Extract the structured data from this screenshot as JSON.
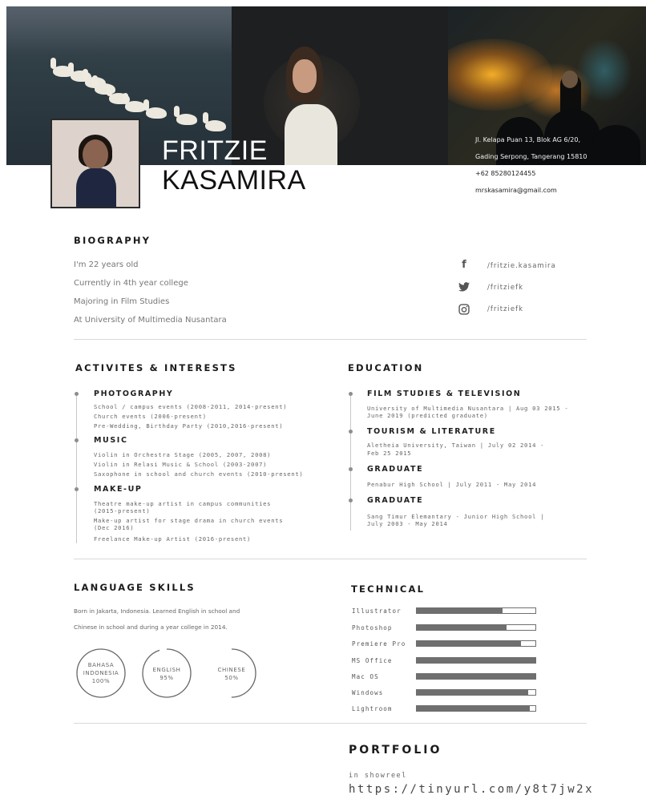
{
  "header": {
    "first_name": "FRITZIE",
    "last_name": "KASAMIRA",
    "address_line1": "Jl. Kelapa Puan 13, Blok AG 6/20,",
    "address_line2": "Gading Serpong, Tangerang 15810",
    "phone": "+62 85280124455",
    "email": "mrskasamira@gmail.com"
  },
  "biography": {
    "heading": "BIOGRAPHY",
    "lines": [
      "I'm 22 years old",
      "Currently in 4th year college",
      "Majoring in Film Studies",
      "At University of Multimedia Nusantara"
    ],
    "social": [
      {
        "icon": "facebook-icon",
        "handle": "/fritzie.kasamira"
      },
      {
        "icon": "twitter-icon",
        "handle": "/fritziefk"
      },
      {
        "icon": "instagram-icon",
        "handle": "/fritziefk"
      }
    ]
  },
  "activities": {
    "heading": "ACTIVITES & INTERESTS",
    "items": [
      {
        "title": "PHOTOGRAPHY",
        "lines": [
          "School / campus events (2008-2011, 2014-present)",
          "Church events (2006-present)",
          "Pre-Wedding, Birthday Party (2010,2016-present)"
        ]
      },
      {
        "title": "MUSIC",
        "lines": [
          "Violin in Orchestra Stage (2005, 2007, 2008)",
          "Violin in Relasi Music & School (2003-2007)",
          "Saxophone in school and church events (2010-present)"
        ]
      },
      {
        "title": "MAKE-UP",
        "lines": [
          "Theatre make-up artist in campus communities",
          "(2015-present)",
          "Make-up artist for stage drama in church events",
          "(Dec 2016)",
          "Freelance Make-up Artist (2016-present)"
        ]
      }
    ]
  },
  "education": {
    "heading": "EDUCATION",
    "items": [
      {
        "title": "FILM STUDIES & TELEVISION",
        "lines": [
          "University of Multimedia Nusantara | Aug 03 2015 -",
          "June 2019 (predicted graduate)"
        ]
      },
      {
        "title": "TOURISM & LITERATURE",
        "lines": [
          "Aletheia University, Taiwan | July 02 2014 -",
          "Feb 25 2015"
        ]
      },
      {
        "title": "GRADUATE",
        "lines": [
          "Penabur High School | July 2011 - May 2014"
        ]
      },
      {
        "title": "GRADUATE",
        "lines": [
          "Sang Timur Elemantary - Junior High School |",
          "July 2003 - May 2014"
        ]
      }
    ]
  },
  "language": {
    "heading": "LANGUAGE SKILLS",
    "text_line1": "Born in Jakarta, Indonesia. Learned English in school and",
    "text_line2": "Chinese in school and during a year college in 2014.",
    "skills": [
      {
        "line1": "BAHASA",
        "line2": "INDONESIA",
        "line3": "100%",
        "value": 100
      },
      {
        "line1": "ENGLISH",
        "line2": "95%",
        "line3": "",
        "value": 95
      },
      {
        "line1": "CHINESE",
        "line2": "50%",
        "line3": "",
        "value": 50
      }
    ]
  },
  "technical": {
    "heading": "TECHNICAL",
    "skills": [
      {
        "name": "Illustrator",
        "level": 0.72
      },
      {
        "name": "Photoshop",
        "level": 0.76
      },
      {
        "name": "Premiere Pro",
        "level": 0.88
      },
      {
        "name": "MS Office",
        "level": 1.0
      },
      {
        "name": "Mac OS",
        "level": 1.0
      },
      {
        "name": "Windows",
        "level": 0.94
      },
      {
        "name": "Lightroom",
        "level": 0.95
      }
    ]
  },
  "portfolio": {
    "heading": "PORTFOLIO",
    "subtitle": "in showreel",
    "link": "https://tinyurl.com/y8t7jw2x"
  }
}
